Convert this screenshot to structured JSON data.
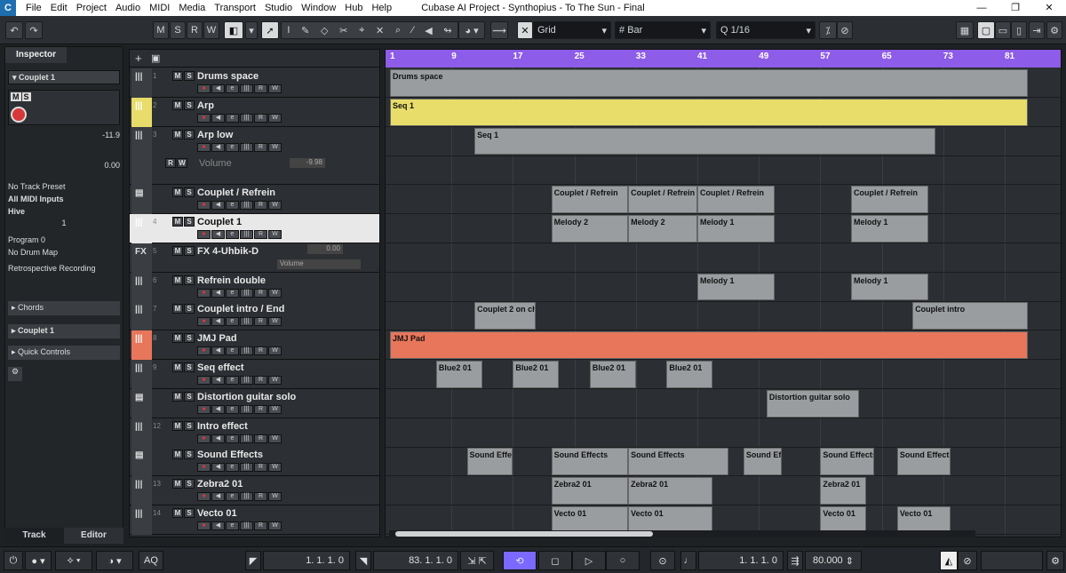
{
  "app": {
    "menu": [
      "File",
      "Edit",
      "Project",
      "Audio",
      "MIDI",
      "Media",
      "Transport",
      "Studio",
      "Window",
      "Hub",
      "Help"
    ],
    "window_title": "Cubase AI Project - Synthopius - To The Sun - Final",
    "win_min": "—",
    "win_max": "❐",
    "win_close": "✕"
  },
  "toolbar": {
    "modes": [
      "M",
      "S",
      "R",
      "W"
    ],
    "snap_label": "Grid",
    "grid_type": "Bar",
    "quantize": "1/16"
  },
  "inspector": {
    "tab": "Inspector",
    "track_name": "Couplet 1",
    "volume": "-11.9",
    "pan": "0.00",
    "preset": "No Track Preset",
    "midi_in": "All MIDI Inputs",
    "output": "Hive",
    "channel": "1",
    "program": "Program 0",
    "drum_map": "No Drum Map",
    "retro": "Retrospective Recording",
    "chords": "Chords",
    "section_track": "Couplet 1",
    "quick_controls": "Quick Controls",
    "bottom_tabs": [
      "Track",
      "Editor"
    ]
  },
  "tracks": [
    {
      "num": "1",
      "type": "|||",
      "name": "Drums space",
      "color": "#3a3d41"
    },
    {
      "num": "2",
      "type": "|||",
      "name": "Arp",
      "color": "#e8dc6a"
    },
    {
      "num": "3",
      "type": "|||",
      "name": "Arp low",
      "color": "#3a3d41"
    },
    {
      "num": "",
      "type": "",
      "name": "Volume",
      "color": "#3a3d41",
      "auto": "-9.98"
    },
    {
      "num": "",
      "type": "▤",
      "name": "Couplet / Refrein",
      "color": "#3a3d41"
    },
    {
      "num": "4",
      "type": "|||",
      "name": "Couplet 1",
      "color": "#e8e8e8"
    },
    {
      "num": "5",
      "type": "FX",
      "name": "FX 4-Uhbik-D",
      "color": "#3a3d41",
      "auto": "0.00",
      "auto_name": "Volume"
    },
    {
      "num": "6",
      "type": "|||",
      "name": "Refrein double",
      "color": "#3a3d41"
    },
    {
      "num": "7",
      "type": "|||",
      "name": "Couplet intro / End",
      "color": "#3a3d41"
    },
    {
      "num": "8",
      "type": "|||",
      "name": "JMJ Pad",
      "color": "#e8765a"
    },
    {
      "num": "9",
      "type": "|||",
      "name": "Seq effect",
      "color": "#3a3d41"
    },
    {
      "num": "",
      "type": "▤",
      "name": "Distortion guitar solo",
      "color": "#3a3d41"
    },
    {
      "num": "12",
      "type": "|||",
      "name": "Intro effect",
      "color": "#3a3d41"
    },
    {
      "num": "",
      "type": "▤",
      "name": "Sound Effects",
      "color": "#3a3d41"
    },
    {
      "num": "13",
      "type": "|||",
      "name": "Zebra2 01",
      "color": "#3a3d41"
    },
    {
      "num": "14",
      "type": "|||",
      "name": "Vecto 01",
      "color": "#3a3d41"
    }
  ],
  "ruler": [
    "1",
    "9",
    "17",
    "25",
    "33",
    "41",
    "49",
    "57",
    "65",
    "73",
    "81"
  ],
  "parts": [
    {
      "lane": 0,
      "start": 1,
      "end": 84,
      "label": "Drums space",
      "color": "#9a9da0"
    },
    {
      "lane": 1,
      "start": 1,
      "end": 84,
      "label": "Seq 1",
      "color": "#e8dc6a"
    },
    {
      "lane": 2,
      "start": 12,
      "end": 72,
      "label": "Seq 1",
      "color": "#9a9da0"
    },
    {
      "lane": 4,
      "start": 22,
      "end": 32,
      "label": "Couplet / Refrein",
      "color": "#9a9da0"
    },
    {
      "lane": 4,
      "start": 32,
      "end": 41,
      "label": "Couplet / Refrein",
      "color": "#9a9da0"
    },
    {
      "lane": 4,
      "start": 41,
      "end": 51,
      "label": "Couplet / Refrein",
      "color": "#9a9da0"
    },
    {
      "lane": 4,
      "start": 61,
      "end": 71,
      "label": "Couplet / Refrein",
      "color": "#9a9da0"
    },
    {
      "lane": 5,
      "start": 22,
      "end": 32,
      "label": "Melody 2",
      "color": "#9a9da0"
    },
    {
      "lane": 5,
      "start": 32,
      "end": 41,
      "label": "Melody 2",
      "color": "#9a9da0"
    },
    {
      "lane": 5,
      "start": 41,
      "end": 51,
      "label": "Melody 1",
      "color": "#9a9da0"
    },
    {
      "lane": 5,
      "start": 61,
      "end": 71,
      "label": "Melody 1",
      "color": "#9a9da0"
    },
    {
      "lane": 7,
      "start": 41,
      "end": 51,
      "label": "Melody 1",
      "color": "#9a9da0"
    },
    {
      "lane": 7,
      "start": 61,
      "end": 71,
      "label": "Melody 1",
      "color": "#9a9da0"
    },
    {
      "lane": 8,
      "start": 12,
      "end": 20,
      "label": "Couplet 2 on chi",
      "color": "#9a9da0"
    },
    {
      "lane": 8,
      "start": 69,
      "end": 84,
      "label": "Couplet intro",
      "color": "#9a9da0"
    },
    {
      "lane": 9,
      "start": 1,
      "end": 84,
      "label": "JMJ Pad",
      "color": "#e8765a"
    },
    {
      "lane": 10,
      "start": 7,
      "end": 13,
      "label": "Blue2 01",
      "color": "#9a9da0"
    },
    {
      "lane": 10,
      "start": 17,
      "end": 23,
      "label": "Blue2 01",
      "color": "#9a9da0"
    },
    {
      "lane": 10,
      "start": 27,
      "end": 33,
      "label": "Blue2 01",
      "color": "#9a9da0"
    },
    {
      "lane": 10,
      "start": 37,
      "end": 43,
      "label": "Blue2 01",
      "color": "#9a9da0"
    },
    {
      "lane": 11,
      "start": 50,
      "end": 62,
      "label": "Distortion guitar solo",
      "color": "#9a9da0"
    },
    {
      "lane": 13,
      "start": 11,
      "end": 17,
      "label": "Sound Effec",
      "color": "#9a9da0"
    },
    {
      "lane": 13,
      "start": 22,
      "end": 32,
      "label": "Sound Effects",
      "color": "#9a9da0"
    },
    {
      "lane": 13,
      "start": 32,
      "end": 45,
      "label": "Sound Effects",
      "color": "#9a9da0"
    },
    {
      "lane": 13,
      "start": 47,
      "end": 52,
      "label": "Sound Eff",
      "color": "#9a9da0"
    },
    {
      "lane": 13,
      "start": 57,
      "end": 64,
      "label": "Sound Effects",
      "color": "#9a9da0"
    },
    {
      "lane": 13,
      "start": 67,
      "end": 74,
      "label": "Sound Effects",
      "color": "#9a9da0"
    },
    {
      "lane": 14,
      "start": 22,
      "end": 32,
      "label": "Zebra2 01",
      "color": "#9a9da0"
    },
    {
      "lane": 14,
      "start": 32,
      "end": 43,
      "label": "Zebra2 01",
      "color": "#9a9da0"
    },
    {
      "lane": 14,
      "start": 57,
      "end": 63,
      "label": "Zebra2 01",
      "color": "#9a9da0"
    },
    {
      "lane": 15,
      "start": 22,
      "end": 32,
      "label": "Vecto 01",
      "color": "#9a9da0"
    },
    {
      "lane": 15,
      "start": 32,
      "end": 43,
      "label": "Vecto 01",
      "color": "#9a9da0"
    },
    {
      "lane": 15,
      "start": 57,
      "end": 63,
      "label": "Vecto 01",
      "color": "#9a9da0"
    },
    {
      "lane": 15,
      "start": 67,
      "end": 74,
      "label": "Vecto 01",
      "color": "#9a9da0"
    }
  ],
  "transport": {
    "aq": "AQ",
    "left_locator": "1. 1. 1.  0",
    "right_locator": "83. 1. 1.  0",
    "position": "1. 1. 1.  0",
    "tempo": "80.000"
  }
}
